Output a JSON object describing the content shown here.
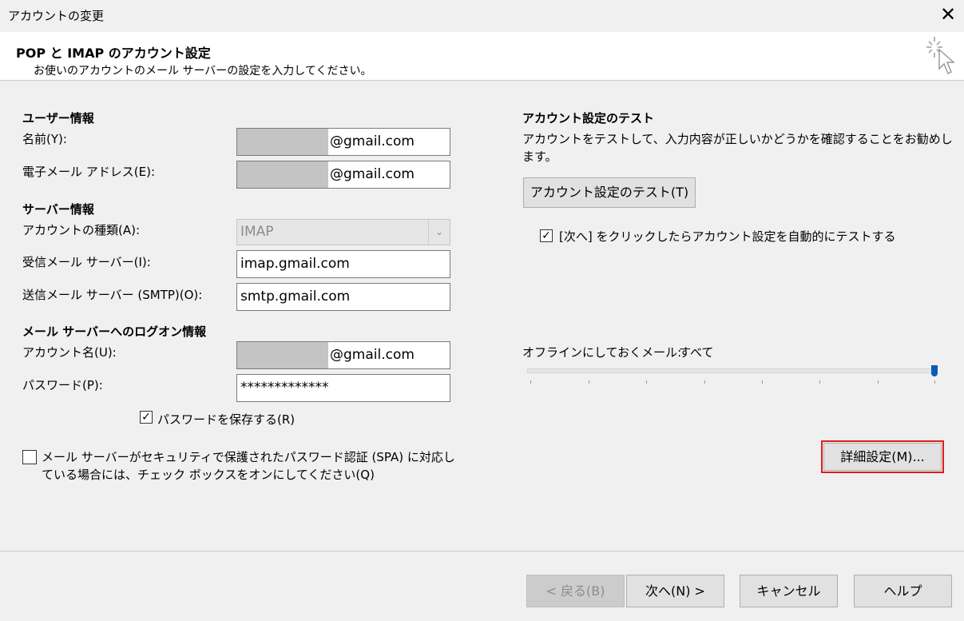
{
  "window": {
    "title": "アカウントの変更",
    "close_glyph": "✕"
  },
  "header": {
    "title": "POP と IMAP のアカウント設定",
    "subtitle": "お使いのアカウントのメール サーバーの設定を入力してください。",
    "icon": "cursor-sparkle-icon"
  },
  "user_info": {
    "heading": "ユーザー情報",
    "name_label": "名前(Y):",
    "name_value": "@gmail.com",
    "email_label": "電子メール アドレス(E):",
    "email_value": "@gmail.com"
  },
  "server_info": {
    "heading": "サーバー情報",
    "account_type_label": "アカウントの種類(A):",
    "account_type_value": "IMAP",
    "incoming_label": "受信メール サーバー(I):",
    "incoming_value": "imap.gmail.com",
    "outgoing_label": "送信メール サーバー (SMTP)(O):",
    "outgoing_value": "smtp.gmail.com"
  },
  "logon_info": {
    "heading": "メール サーバーへのログオン情報",
    "account_name_label": "アカウント名(U):",
    "account_name_value": "@gmail.com",
    "password_label": "パスワード(P):",
    "password_value": "*************",
    "save_password_label": "パスワードを保存する(R)",
    "save_password_checked": true,
    "spa_label_line1": "メール サーバーがセキュリティで保護されたパスワード認証 (SPA) に対応し",
    "spa_label_line2": "ている場合には、チェック ボックスをオンにしてください(Q)",
    "spa_checked": false
  },
  "test": {
    "heading": "アカウント設定のテスト",
    "desc_line1": "アカウントをテストして、入力内容が正しいかどうかを確認することをお勧めし",
    "desc_line2": "ます。",
    "button": "アカウント設定のテスト(T)",
    "auto_test_label": "[次へ] をクリックしたらアカウント設定を自動的にテストする",
    "auto_test_checked": true
  },
  "offline": {
    "label": "オフラインにしておくメール:",
    "value": "すべて",
    "level": 1.0
  },
  "advanced_button": "詳細設定(M)...",
  "footer": {
    "back": "< 戻る(B)",
    "next": "次へ(N) >",
    "cancel": "キャンセル",
    "help": "ヘルプ"
  },
  "colors": {
    "highlight": "#e11b1b",
    "slider_thumb": "#0a5bb5",
    "mask": "#c4c4c4"
  }
}
